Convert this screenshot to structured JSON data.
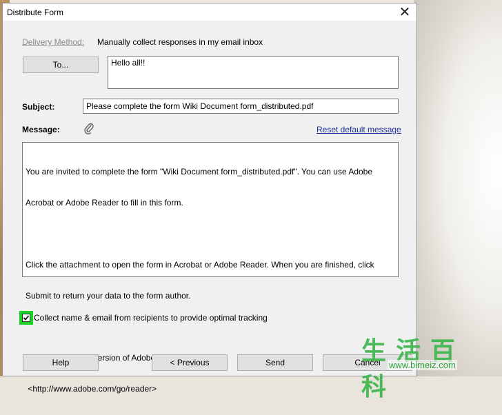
{
  "dialog": {
    "title": "Distribute Form",
    "close_glyph": "✕"
  },
  "delivery": {
    "label": "Delivery Method:",
    "value": "Manually collect responses in my email inbox"
  },
  "to": {
    "button_label": "To...",
    "value": "Hello all!!"
  },
  "subject": {
    "label": "Subject:",
    "value": "Please complete the form Wiki Document form_distributed.pdf"
  },
  "message": {
    "label": "Message:",
    "attach_icon": "paperclip-icon",
    "reset_link": "Reset default message",
    "lines": [
      "You are invited to complete the form \"Wiki Document form_distributed.pdf\". You can use Adobe",
      "Acrobat or Adobe Reader to fill in this form.",
      "",
      "Click the attachment to open the form in Acrobat or Adobe Reader. When you are finished, click",
      "Submit to return your data to the form author.",
      "",
      "Get the free latest version of Adobe Reader from:",
      " <http://www.adobe.com/go/reader>"
    ]
  },
  "tracking": {
    "checked": true,
    "label": "Collect name & email from recipients to provide optimal tracking"
  },
  "buttons": {
    "help": "Help",
    "previous": "< Previous",
    "send": "Send",
    "cancel": "Cancel"
  },
  "watermark": {
    "chars": "生活百科",
    "url": "www.bimeiz.com"
  },
  "colors": {
    "dialog_bg": "#f0f0f0",
    "link": "#1a2f9e",
    "checkbox_highlight": "#19d025"
  }
}
